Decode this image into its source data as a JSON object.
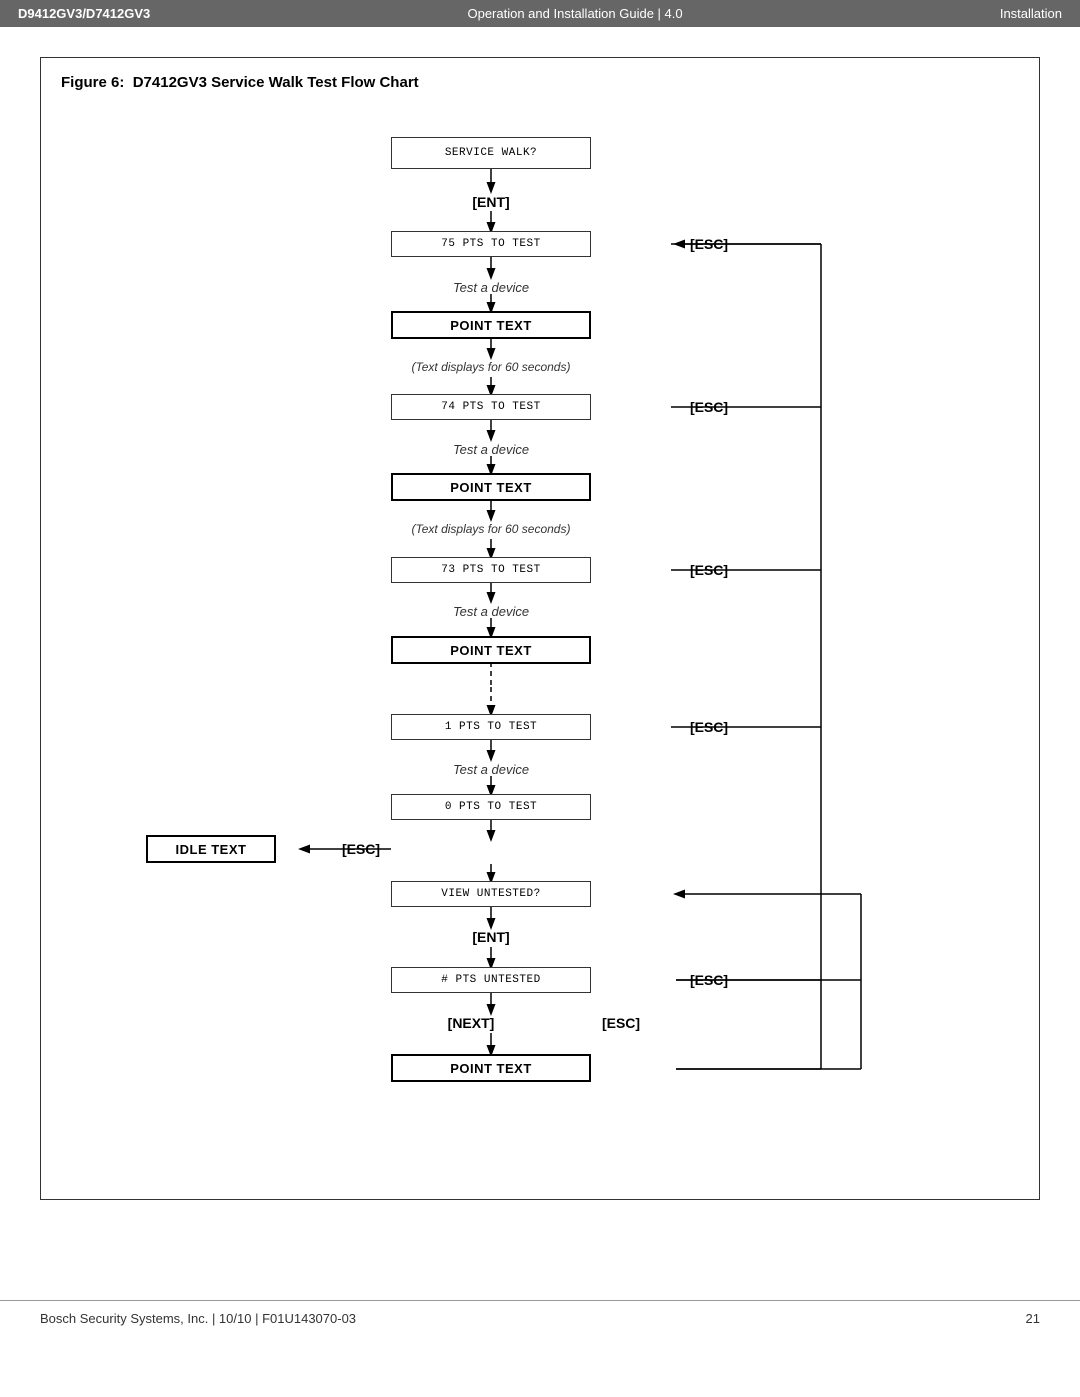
{
  "header": {
    "title": "D9412GV3/D7412GV3",
    "subtitle": "Operation and Installation Guide | 4.0",
    "section": "Installation"
  },
  "figure": {
    "number": "6:",
    "title": "D7412GV3 Service Walk Test Flow Chart"
  },
  "flowchart": {
    "nodes": {
      "service_walk": "SERVICE WALK?",
      "ent1": "[ENT]",
      "pts75": "75 PTS TO TEST",
      "esc1": "[ESC]",
      "test_device1": "Test a device",
      "point_text1": "POINT TEXT",
      "text_60s1": "(Text displays for 60 seconds)",
      "pts74": "74 PTS TO TEST",
      "esc2": "[ESC]",
      "test_device2": "Test a device",
      "point_text2": "POINT TEXT",
      "text_60s2": "(Text displays for 60 seconds)",
      "pts73": "73 PTS TO TEST",
      "esc3": "[ESC]",
      "test_device3": "Test a device",
      "point_text3": "POINT TEXT",
      "pts1": "1 PTS TO TEST",
      "esc4": "[ESC]",
      "test_device4": "Test a device",
      "pts0": "0 PTS TO TEST",
      "idle_text": "IDLE TEXT",
      "esc5": "[ESC]",
      "view_untested": "VIEW UNTESTED?",
      "ent2": "[ENT]",
      "pts_untested": "# PTS UNTESTED",
      "esc6": "[ESC]",
      "next": "[NEXT]",
      "esc7": "[ESC]",
      "point_text_final": "POINT TEXT"
    }
  },
  "footer": {
    "left": "Bosch Security Systems, Inc. | 10/10 | F01U143070-03",
    "right": "21"
  }
}
